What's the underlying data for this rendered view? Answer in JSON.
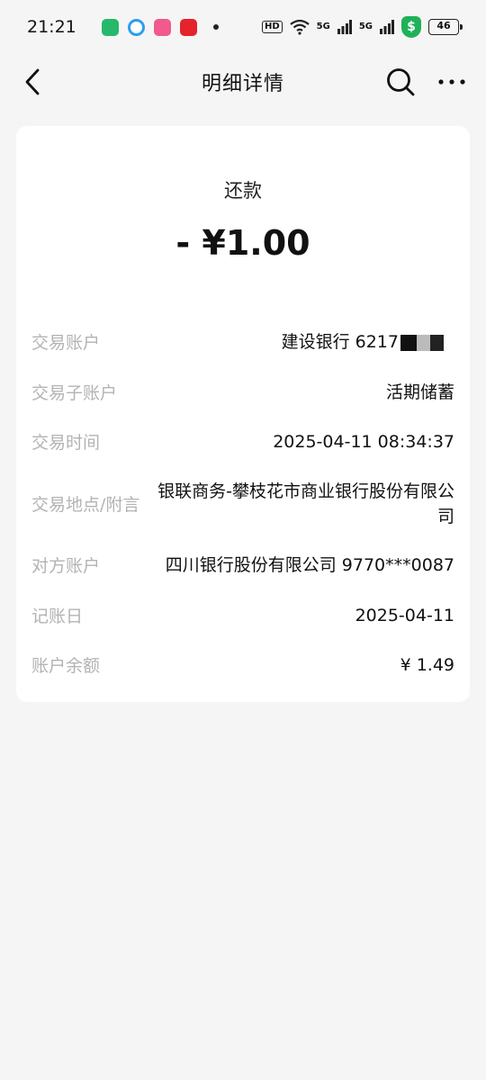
{
  "status_bar": {
    "time": "21:21",
    "hd": "HD",
    "signal1": "5G",
    "signal2": "5G",
    "battery": "46"
  },
  "nav": {
    "title": "明细详情"
  },
  "transaction": {
    "type": "还款",
    "amount": "- ¥1.00"
  },
  "details": [
    {
      "label": "交易账户",
      "value": "建设银行 6217"
    },
    {
      "label": "交易子账户",
      "value": "活期储蓄"
    },
    {
      "label": "交易时间",
      "value": "2025-04-11 08:34:37"
    },
    {
      "label": "交易地点/附言",
      "value": "银联商务-攀枝花市商业银行股份有限公司"
    },
    {
      "label": "对方账户",
      "value": "四川银行股份有限公司 9770***0087"
    },
    {
      "label": "记账日",
      "value": "2025-04-11"
    },
    {
      "label": "账户余额",
      "value": "¥ 1.49"
    }
  ],
  "colors": {
    "background": "#f5f5f5",
    "card": "#ffffff",
    "label": "#b3b3b3",
    "value": "#111111",
    "shield": "#20b15a"
  }
}
